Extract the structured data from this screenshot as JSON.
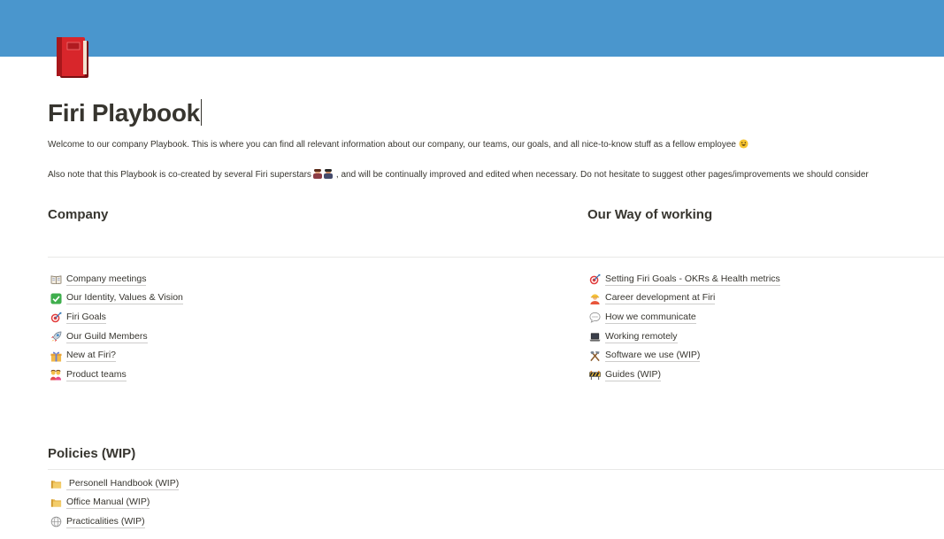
{
  "page": {
    "cover_color": "#4a96cd",
    "icon": "red-book-icon",
    "title": "Firi Playbook",
    "intro_1": "Welcome to our company Playbook. This is where you can find all relevant information about our company, our teams, our goals, and all nice-to-know stuff as a fellow employee",
    "intro_1_emoji": "😃",
    "intro_2_a": "Also note that this Playbook is co-created by several Firi superstars",
    "intro_2_emoji": "👩‍🚀👨‍🚀",
    "intro_2_b": ", and will be continually improved and edited when necessary. Do not hesitate to suggest other pages/improvements we should consider"
  },
  "sections": {
    "company": {
      "heading": "Company",
      "items": [
        {
          "icon": "open-book-icon",
          "label": "Company meetings"
        },
        {
          "icon": "check-mark-icon",
          "label": "Our Identity, Values & Vision"
        },
        {
          "icon": "target-icon",
          "label": "Firi Goals"
        },
        {
          "icon": "rocket-icon",
          "label": "Our Guild Members"
        },
        {
          "icon": "gift-icon",
          "label": "New at Firi?"
        },
        {
          "icon": "people-icon",
          "label": "Product teams"
        }
      ]
    },
    "way_of_working": {
      "heading": "Our Way of working",
      "items": [
        {
          "icon": "target-icon",
          "label": "Setting Firi Goals - OKRs & Health metrics"
        },
        {
          "icon": "worker-icon",
          "label": "Career development at Firi"
        },
        {
          "icon": "speech-bubble-icon",
          "label": "How we communicate"
        },
        {
          "icon": "laptop-icon",
          "label": "Working remotely"
        },
        {
          "icon": "tools-icon",
          "label": "Software we use (WIP)"
        },
        {
          "icon": "construction-icon",
          "label": "Guides (WIP)"
        }
      ]
    },
    "policies": {
      "heading": "Policies (WIP)",
      "items": [
        {
          "icon": "folder-icon",
          "label": " Personell Handbook (WIP)"
        },
        {
          "icon": "folder-icon",
          "label": "Office Manual (WIP)"
        },
        {
          "icon": "globe-icon",
          "label": "Practicalities (WIP)"
        }
      ]
    }
  }
}
